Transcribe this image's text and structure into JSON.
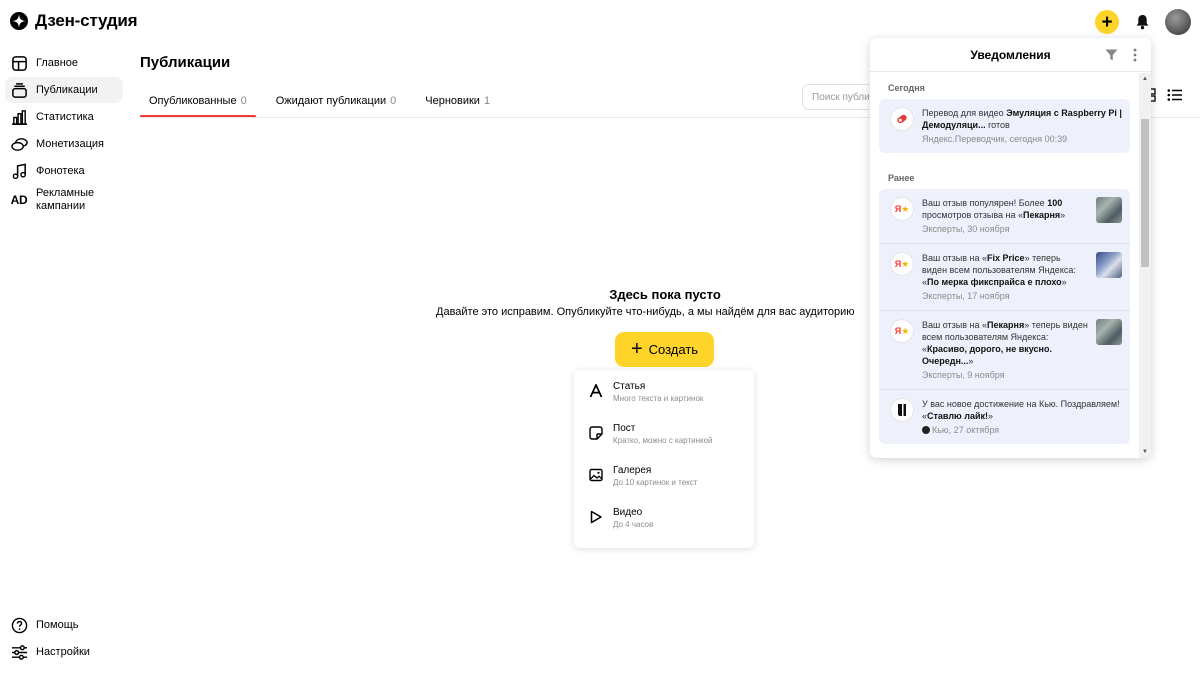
{
  "app": {
    "title": "Дзен-студия"
  },
  "sidebar": {
    "items": [
      {
        "label": "Главное",
        "icon": "home-icon",
        "active": false
      },
      {
        "label": "Публикации",
        "icon": "publications-icon",
        "active": true
      },
      {
        "label": "Статистика",
        "icon": "chart-icon",
        "active": false
      },
      {
        "label": "Монетизация",
        "icon": "coins-icon",
        "active": false
      },
      {
        "label": "Фонотека",
        "icon": "music-icon",
        "active": false
      },
      {
        "label": "Рекламные кампании",
        "icon": "ad-icon",
        "active": false
      }
    ],
    "bottom": [
      {
        "label": "Помощь",
        "icon": "help-icon"
      },
      {
        "label": "Настройки",
        "icon": "settings-icon"
      }
    ]
  },
  "main": {
    "title": "Публикации",
    "tabs": [
      {
        "label": "Опубликованные",
        "count": "0",
        "active": true
      },
      {
        "label": "Ожидают публикации",
        "count": "0",
        "active": false
      },
      {
        "label": "Черновики",
        "count": "1",
        "active": false
      }
    ],
    "search_placeholder": "Поиск публикаций",
    "empty": {
      "title": "Здесь пока пусто",
      "subtitle": "Давайте это исправим. Опубликуйте что-нибудь, а мы найдём для вас аудиторию"
    },
    "create_button": "Создать",
    "create_menu": [
      {
        "title": "Статья",
        "desc": "Много текста и картинок",
        "icon": "article-icon"
      },
      {
        "title": "Пост",
        "desc": "Кратко, можно с картинкой",
        "icon": "post-icon"
      },
      {
        "title": "Галерея",
        "desc": "До 10 картинок и текст",
        "icon": "gallery-icon"
      },
      {
        "title": "Видео",
        "desc": "До 4 часов",
        "icon": "video-play-icon"
      }
    ]
  },
  "notifications": {
    "title": "Уведомления",
    "sections": {
      "today": "Сегодня",
      "earlier": "Ранее"
    },
    "today": [
      {
        "pre": "Перевод для видео ",
        "bold": "Эмуляция с Raspberry Pi | Демодуляци...",
        "post": " готов",
        "meta": "Яндекс.Переводчик, сегодня 00:39"
      }
    ],
    "earlier": [
      {
        "pre": "Ваш отзыв популярен! Более ",
        "bold": "100",
        "post": " просмотров отзыва на «",
        "bold2": "Пекарня",
        "post2": "»",
        "meta": "Эксперты, 30 ноября"
      },
      {
        "pre": "Ваш отзыв на «",
        "bold": "Fix Price",
        "post": "» теперь виден всем пользователям Яндекса: «",
        "bold2": "По мерка фикспрайса е плохо",
        "post2": "»",
        "meta": "Эксперты, 17 ноября"
      },
      {
        "pre": "Ваш отзыв на «",
        "bold": "Пекарня",
        "post": "» теперь виден всем пользователям Яндекса: «",
        "bold2": "Красиво, дорого, не вкусно. Очередн...",
        "post2": "»",
        "meta": "Эксперты, 9 ноября"
      },
      {
        "pre": "У вас новое достижение на Кью. Поздравляем! «",
        "bold": "Ставлю лайк!",
        "post": "»",
        "meta": "Кью, 27 октября"
      }
    ]
  }
}
